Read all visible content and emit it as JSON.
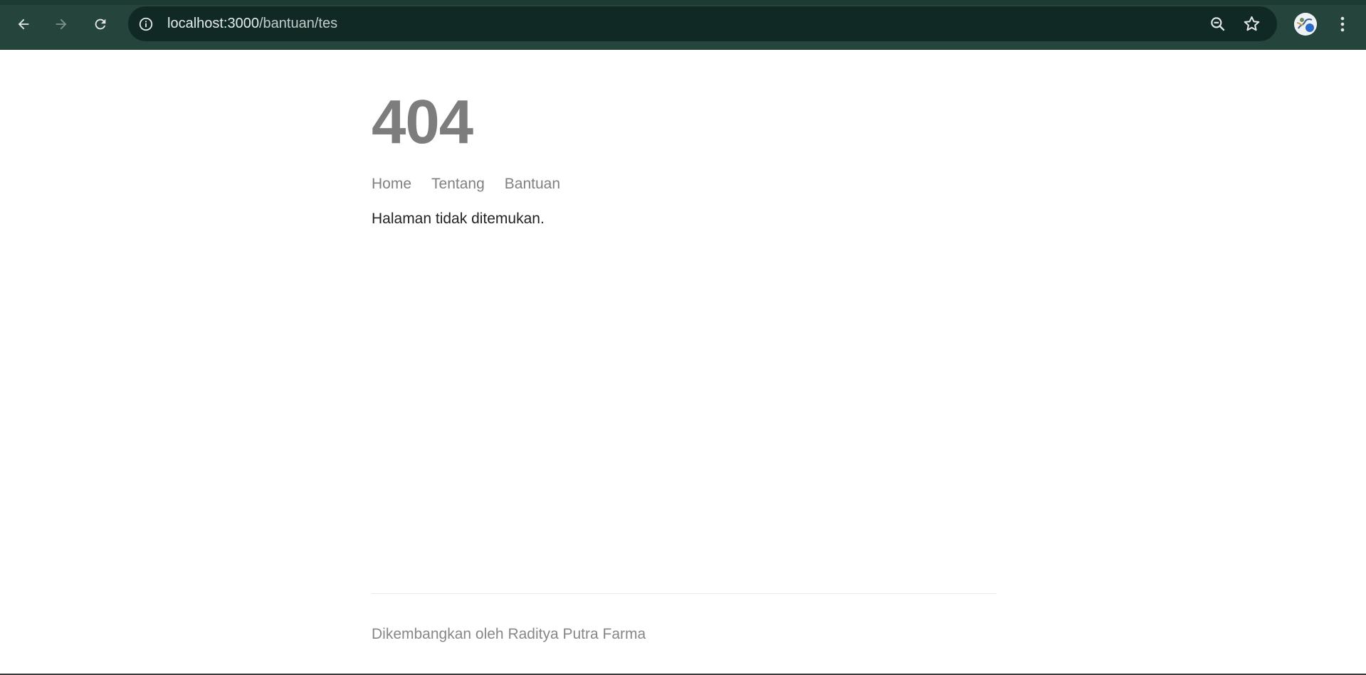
{
  "browser": {
    "url_host": "localhost:3000",
    "url_path": "/bantuan/tes",
    "icons": {
      "back": "arrow-left-icon",
      "forward": "arrow-right-icon",
      "reload": "reload-icon",
      "site_info": "info-icon",
      "zoom": "zoom-out-icon",
      "bookmark": "star-icon",
      "profile": "avatar",
      "menu": "more-vert-icon"
    },
    "colors": {
      "chrome_bg": "#24443c",
      "omnibox_bg": "#112925"
    }
  },
  "page": {
    "title": "404",
    "nav": [
      {
        "label": "Home"
      },
      {
        "label": "Tentang"
      },
      {
        "label": "Bantuan"
      }
    ],
    "message": "Halaman tidak ditemukan.",
    "footer": "Dikembangkan oleh Raditya Putra Farma",
    "colors": {
      "title": "#7d7d7d",
      "link": "#808080",
      "text": "#222222"
    }
  }
}
